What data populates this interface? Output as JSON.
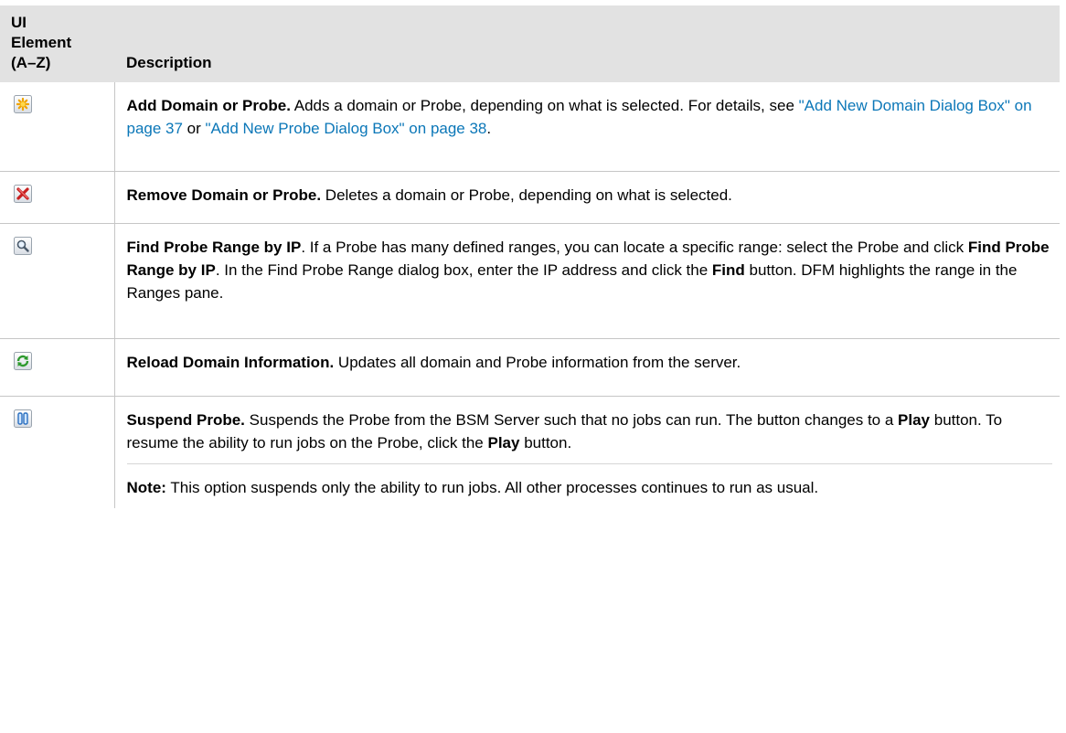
{
  "header": {
    "col1": "UI Element (A–Z)",
    "col1_lines": [
      "UI",
      "Element",
      "(A–Z)"
    ],
    "col2": "Description"
  },
  "rows": [
    {
      "icon": "add-star-icon",
      "title": "Add Domain or Probe.",
      "text_a": " Adds a domain or Probe, depending on what is selected. For details, see ",
      "link1": "\"Add New Domain Dialog Box\" on page 37",
      "text_b": " or ",
      "link2": "\"Add New Probe Dialog Box\" on page 38",
      "text_c": "."
    },
    {
      "icon": "remove-x-icon",
      "title": "Remove Domain or Probe.",
      "text_a": " Deletes a domain or Probe, depending on what is selected."
    },
    {
      "icon": "magnifier-icon",
      "title": "Find Probe Range by IP",
      "text_a": ". If a Probe has many defined ranges, you can locate a specific range: select the Probe and click ",
      "bold2": "Find Probe Range by IP",
      "text_b": ". In the Find Probe Range dialog box, enter the IP address and click the ",
      "bold3": "Find",
      "text_c": " button. DFM highlights the range in the Ranges pane."
    },
    {
      "icon": "reload-icon",
      "title": "Reload Domain Information.",
      "text_a": " Updates all domain and Probe information from the server."
    },
    {
      "icon": "pause-icon",
      "title": "Suspend Probe.",
      "text_a": " Suspends the Probe from the BSM Server such that no jobs can run. The button changes to a ",
      "bold2": "Play",
      "text_b": " button. To resume the ability to run jobs on the Probe, click the ",
      "bold3": "Play",
      "text_c": " button.",
      "note_label": "Note:",
      "note_text": " This option suspends only the ability to run jobs. All other processes continues to run as usual."
    }
  ]
}
